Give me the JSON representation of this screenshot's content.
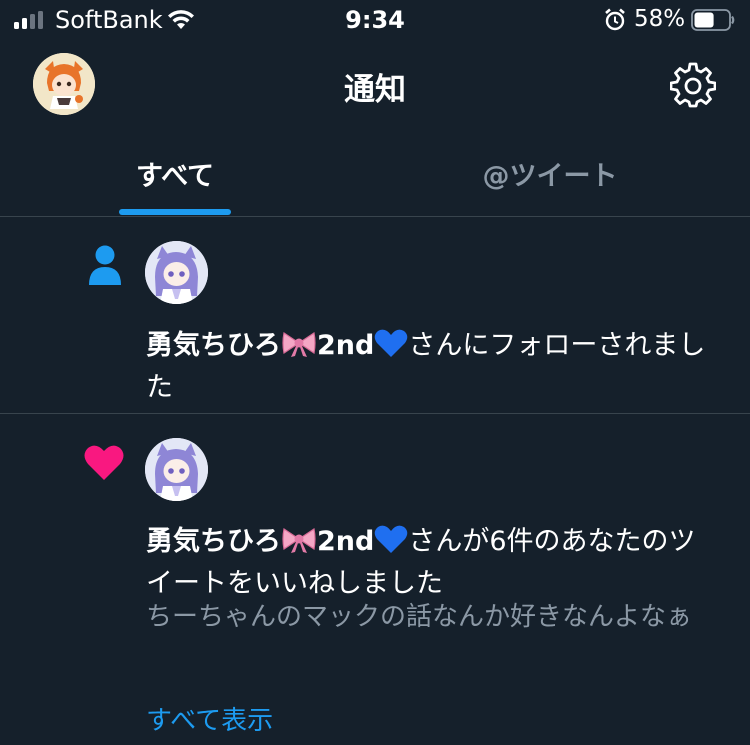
{
  "status_bar": {
    "carrier": "SoftBank",
    "time": "9:34",
    "battery": "58%",
    "battery_level": 0.58
  },
  "header": {
    "title": "通知"
  },
  "tabs": [
    {
      "label": "すべて",
      "selected": true
    },
    {
      "label": "@ツイート",
      "selected": false
    }
  ],
  "notifications": [
    {
      "type": "follow",
      "icon": "person-icon",
      "name": "勇気ちひろ",
      "name_suffix": "2nd",
      "text": "さんにフォローされました"
    },
    {
      "type": "like",
      "icon": "heart-icon",
      "name": "勇気ちひろ",
      "name_suffix": "2nd",
      "text": "さんが6件のあなたのツイートをいいねしました",
      "preview": "ちーちゃんのマックの話なんか好きなんよなぁ",
      "show_all": "すべて表示"
    }
  ],
  "colors": {
    "background": "#15202b",
    "accent": "#1d9bf0",
    "like": "#f91880",
    "muted": "#8b98a5",
    "divider": "#38444d"
  }
}
